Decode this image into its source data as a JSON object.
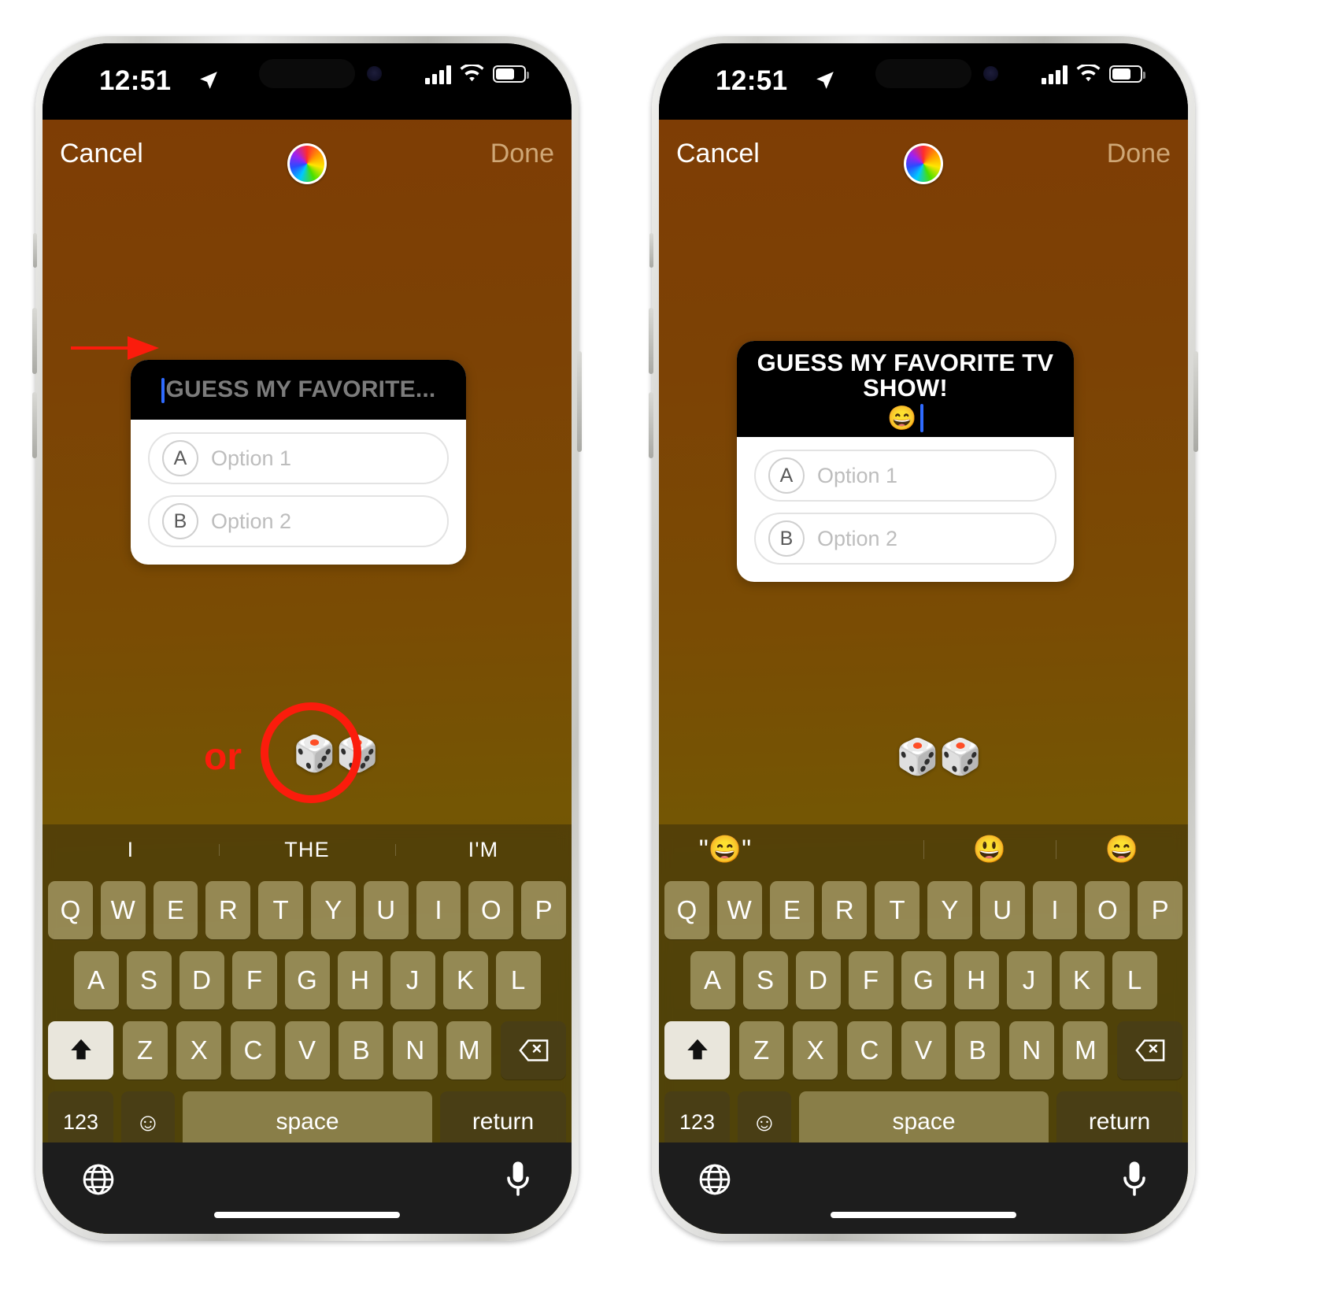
{
  "meta": {
    "description": "Two iPhone screenshots side by side showing Instagram Story poll/quiz sticker text entry",
    "accent_red": "#fb1c0c",
    "done_color": "#cfa776",
    "caret_color": "#2f6bff",
    "background_gradient_top": "#7e3d05",
    "background_gradient_bottom": "#6a5c06"
  },
  "status_bar": {
    "time": "12:51",
    "location_icon": "location-arrow-icon",
    "cellular_icon": "cellular-bars-icon",
    "wifi_icon": "wifi-icon",
    "battery_icon": "battery-icon"
  },
  "nav": {
    "cancel_label": "Cancel",
    "done_label": "Done",
    "color_picker_icon": "color-wheel-icon"
  },
  "phone_left": {
    "poll": {
      "question_placeholder": "GUESS MY FAVORITE...",
      "question_value": "",
      "options": [
        {
          "badge": "A",
          "placeholder": "Option 1",
          "value": ""
        },
        {
          "badge": "B",
          "placeholder": "Option 2",
          "value": ""
        }
      ]
    },
    "annotation": {
      "arrow_icon": "red-arrow-icon",
      "or_label": "or",
      "dice_icon": "game-die-icon",
      "dice_glyph": "🎲🎲",
      "circle_icon": "red-circle-highlight-icon"
    },
    "keyboard": {
      "suggestions": [
        "I",
        "THE",
        "I'M"
      ],
      "row1": [
        "Q",
        "W",
        "E",
        "R",
        "T",
        "Y",
        "U",
        "I",
        "O",
        "P"
      ],
      "row2": [
        "A",
        "S",
        "D",
        "F",
        "G",
        "H",
        "J",
        "K",
        "L"
      ],
      "row3": [
        "Z",
        "X",
        "C",
        "V",
        "B",
        "N",
        "M"
      ],
      "shift_icon": "shift-arrow-icon",
      "backspace_icon": "backspace-icon",
      "numbers_label": "123",
      "emoji_icon": "emoji-smiley-icon",
      "space_label": "space",
      "return_label": "return",
      "globe_icon": "globe-icon",
      "mic_icon": "microphone-icon"
    }
  },
  "phone_right": {
    "poll": {
      "question_value": "GUESS MY FAVORITE TV SHOW!",
      "question_emoji": "😄",
      "options": [
        {
          "badge": "A",
          "placeholder": "Option 1",
          "value": ""
        },
        {
          "badge": "B",
          "placeholder": "Option 2",
          "value": ""
        }
      ]
    },
    "annotation": {
      "dice_icon": "game-die-icon",
      "dice_glyph": "🎲🎲"
    },
    "keyboard": {
      "suggestions": [
        "\"😄\"",
        "",
        "😃",
        "😄"
      ],
      "row1": [
        "Q",
        "W",
        "E",
        "R",
        "T",
        "Y",
        "U",
        "I",
        "O",
        "P"
      ],
      "row2": [
        "A",
        "S",
        "D",
        "F",
        "G",
        "H",
        "J",
        "K",
        "L"
      ],
      "row3": [
        "Z",
        "X",
        "C",
        "V",
        "B",
        "N",
        "M"
      ],
      "shift_icon": "shift-arrow-icon",
      "backspace_icon": "backspace-icon",
      "numbers_label": "123",
      "emoji_icon": "emoji-smiley-icon",
      "space_label": "space",
      "return_label": "return",
      "globe_icon": "globe-icon",
      "mic_icon": "microphone-icon"
    }
  }
}
